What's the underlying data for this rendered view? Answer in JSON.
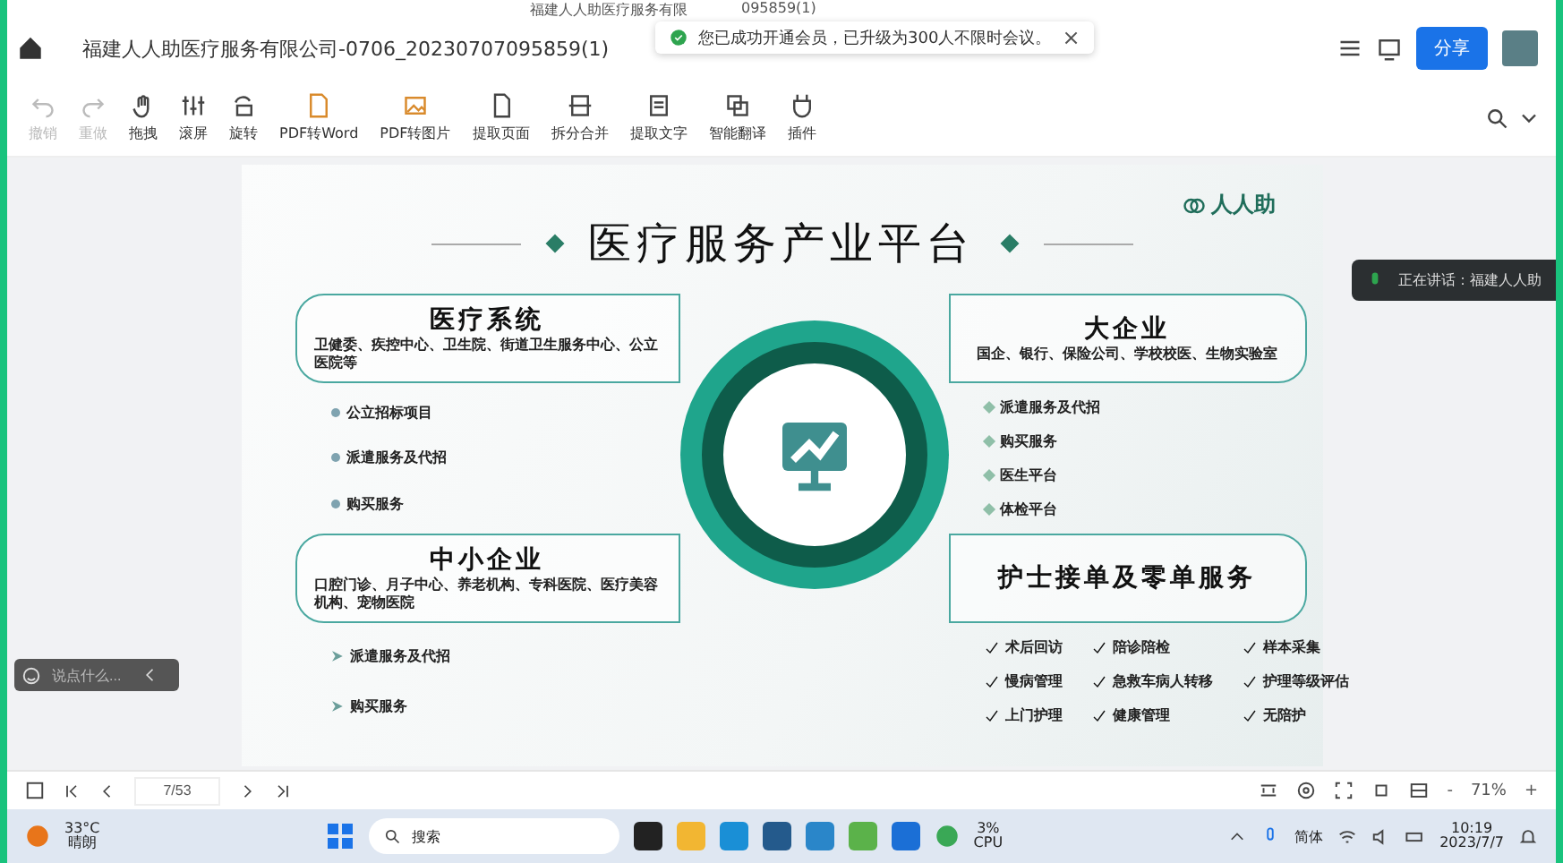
{
  "top_strip": {
    "left": "福建人人助医疗服务有限",
    "right": "095859(1)"
  },
  "header": {
    "title": "福建人人助医疗服务有限公司-0706_20230707095859(1)",
    "share": "分享"
  },
  "toast": {
    "text": "您已成功开通会员，已升级为300人不限时会议。",
    "close": "×"
  },
  "toolbar": [
    {
      "label": "撤销",
      "disabled": true
    },
    {
      "label": "重做",
      "disabled": true
    },
    {
      "label": "拖拽",
      "disabled": false
    },
    {
      "label": "滚屏",
      "disabled": false
    },
    {
      "label": "旋转",
      "disabled": false
    },
    {
      "label": "PDF转Word",
      "disabled": false
    },
    {
      "label": "PDF转图片",
      "disabled": false
    },
    {
      "label": "提取页面",
      "disabled": false
    },
    {
      "label": "拆分合并",
      "disabled": false
    },
    {
      "label": "提取文字",
      "disabled": false
    },
    {
      "label": "智能翻译",
      "disabled": false
    },
    {
      "label": "插件",
      "disabled": false
    }
  ],
  "slide": {
    "title": "医疗服务产业平台",
    "logo": "人人助",
    "sections": [
      {
        "title": "医疗系统",
        "desc": "卫健委、疾控中心、卫生院、街道卫生服务中心、公立医院等",
        "kind": "dot",
        "items": [
          "公立招标项目",
          "派遣服务及代招",
          "购买服务"
        ]
      },
      {
        "title": "大企业",
        "desc": "国企、银行、保险公司、学校校医、生物实验室",
        "kind": "diamond",
        "items": [
          "派遣服务及代招",
          "购买服务",
          "医生平台",
          "体检平台"
        ]
      },
      {
        "title": "中小企业",
        "desc": "口腔门诊、月子中心、养老机构、专科医院、医疗美容机构、宠物医院",
        "kind": "arrow",
        "items": [
          "派遣服务及代招",
          "购买服务"
        ]
      },
      {
        "title": "护士接单及零单服务",
        "kind": "check",
        "items": [
          "术后回访",
          "陪诊陪检",
          "样本采集",
          "慢病管理",
          "急救车病人转移",
          "护理等级评估",
          "上门护理",
          "健康管理",
          "无陪护"
        ]
      }
    ]
  },
  "speaking": {
    "text": "正在讲话：福建人人助"
  },
  "chat": {
    "placeholder": "说点什么..."
  },
  "pager": {
    "page": "7/53",
    "zoom": "71%",
    "minus": "-",
    "plus": "+"
  },
  "taskbar": {
    "temp": "33°C",
    "weather": "晴朗",
    "search": "搜索",
    "cpu": "3%",
    "cpu_label": "CPU",
    "ime": "简体",
    "time": "10:19",
    "date": "2023/7/7"
  }
}
